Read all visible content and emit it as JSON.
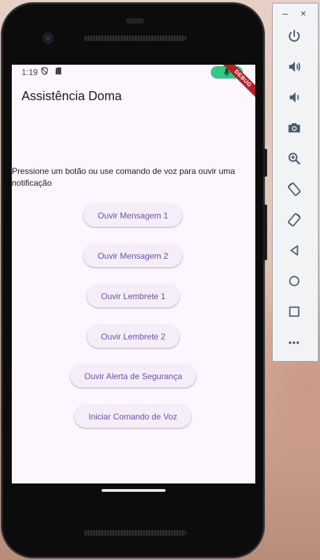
{
  "status_bar": {
    "time": "1:19",
    "debug_label": "DEBUG"
  },
  "app": {
    "title": "Assistência Doma",
    "prompt": "Pressione um botão ou use comando de voz para ouvir uma notificação",
    "buttons": [
      {
        "label": "Ouvir Mensagem 1"
      },
      {
        "label": "Ouvir Mensagem 2"
      },
      {
        "label": "Ouvir Lembrete 1"
      },
      {
        "label": "Ouvir Lembrete 2"
      },
      {
        "label": "Ouvir Alerta de Segurança"
      },
      {
        "label": "Iniciar Comando de Voz"
      }
    ]
  },
  "emulator_toolbar": {
    "minimize_label": "–",
    "close_label": "×",
    "more_label": "•••",
    "icons": [
      "power-icon",
      "volume-up-icon",
      "volume-down-icon",
      "camera-icon",
      "zoom-icon",
      "rotate-left-icon",
      "rotate-right-icon",
      "back-icon",
      "home-icon",
      "overview-icon",
      "more-icon"
    ]
  },
  "colors": {
    "screen_bg": "#fcf7fe",
    "button_text": "#6750a4",
    "button_bg": "#f5eef9",
    "mic_pill": "#34c785",
    "debug_banner": "#b1202b"
  }
}
